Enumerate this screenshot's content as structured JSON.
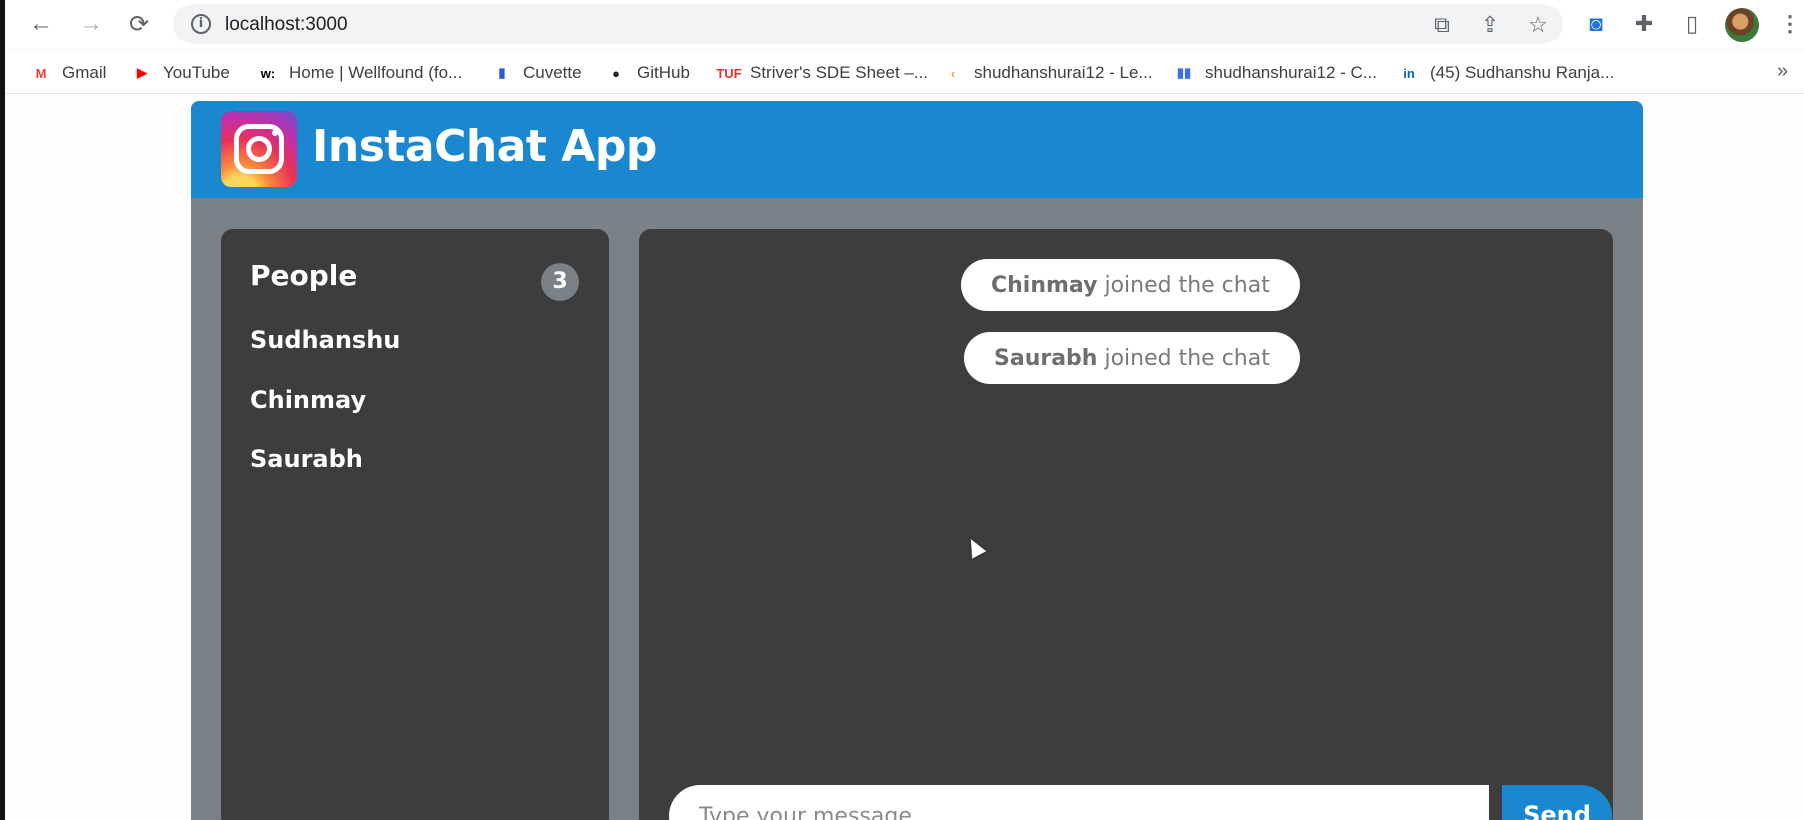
{
  "browser": {
    "url": "localhost:3000",
    "nav": {
      "back_icon": "←",
      "forward_icon": "→",
      "reload_icon": "⟳"
    },
    "bookmarks": [
      {
        "label": "Gmail",
        "icon": "gmail-icon",
        "glyph": "M",
        "color": "#ea4335"
      },
      {
        "label": "YouTube",
        "icon": "youtube-icon",
        "glyph": "▶",
        "color": "#ff0000"
      },
      {
        "label": "Home | Wellfound (fo...",
        "icon": "wellfound-icon",
        "glyph": "w:",
        "color": "#000000"
      },
      {
        "label": "Cuvette",
        "icon": "cuvette-icon",
        "glyph": "▮",
        "color": "#2a5ad7"
      },
      {
        "label": "GitHub",
        "icon": "github-icon",
        "glyph": "●",
        "color": "#24292f"
      },
      {
        "label": "Striver's SDE Sheet –...",
        "icon": "tuf-icon",
        "glyph": "TUF",
        "color": "#e8312f"
      },
      {
        "label": "shudhanshurai12 - Le...",
        "icon": "leetcode-icon",
        "glyph": "‹",
        "color": "#f0a23b"
      },
      {
        "label": "shudhanshurai12 - C...",
        "icon": "codechef-icon",
        "glyph": "▮▮",
        "color": "#3b6ee8"
      },
      {
        "label": "(45) Sudhanshu Ranja...",
        "icon": "linkedin-icon",
        "glyph": "in",
        "color": "#0a66c2"
      }
    ],
    "more_glyph": "»"
  },
  "app": {
    "title": "InstaChat App",
    "accent": "#1a88d1",
    "people": {
      "heading": "People",
      "count": "3",
      "list": [
        "Sudhanshu",
        "Chinmay",
        "Saurabh"
      ]
    },
    "messages": [
      {
        "name": "Chinmay",
        "text": "joined the chat"
      },
      {
        "name": "Saurabh",
        "text": "joined the chat"
      }
    ],
    "composer": {
      "placeholder": "Type your message",
      "send_label": "Send"
    }
  }
}
